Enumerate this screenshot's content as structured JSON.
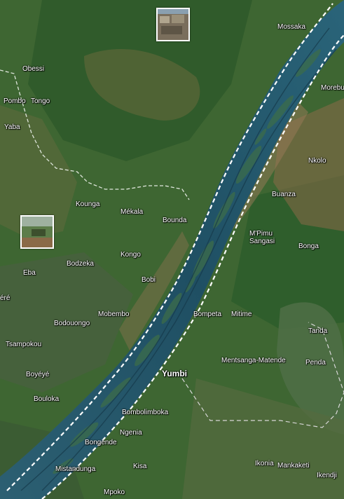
{
  "map": {
    "places": [
      {
        "id": "mossaka",
        "name": "Mossaka"
      },
      {
        "id": "obessi",
        "name": "Obessi"
      },
      {
        "id": "pombo",
        "name": "Pombo"
      },
      {
        "id": "tongo",
        "name": "Tongo"
      },
      {
        "id": "morebu",
        "name": "Morebu"
      },
      {
        "id": "yaba",
        "name": "Yaba"
      },
      {
        "id": "nkolo",
        "name": "Nkolo"
      },
      {
        "id": "buanza",
        "name": "Buanza"
      },
      {
        "id": "kounga",
        "name": "Kounga"
      },
      {
        "id": "mekala",
        "name": "Mékala"
      },
      {
        "id": "bounda",
        "name": "Bounda"
      },
      {
        "id": "mpimu",
        "name": "M'Pimu"
      },
      {
        "id": "sangasi",
        "name": "Sangasi"
      },
      {
        "id": "bonga",
        "name": "Bonga"
      },
      {
        "id": "kongo",
        "name": "Kongo"
      },
      {
        "id": "bodzeka",
        "name": "Bodzeka"
      },
      {
        "id": "eba",
        "name": "Eba"
      },
      {
        "id": "bobi",
        "name": "Bobi"
      },
      {
        "id": "ere",
        "name": "éré"
      },
      {
        "id": "mobembo",
        "name": "Mobembo"
      },
      {
        "id": "bompeta",
        "name": "Bompeta"
      },
      {
        "id": "mitime",
        "name": "Mitime"
      },
      {
        "id": "bodouongo",
        "name": "Bodouongo"
      },
      {
        "id": "tanda",
        "name": "Tanda"
      },
      {
        "id": "tsampokou",
        "name": "Tsampokou"
      },
      {
        "id": "mentsanga",
        "name": "Mentsanga-Matende"
      },
      {
        "id": "penda",
        "name": "Penda"
      },
      {
        "id": "boyeye",
        "name": "Boyéyé"
      },
      {
        "id": "yumbi",
        "name": "Yumbi"
      },
      {
        "id": "bouloka",
        "name": "Bouloka"
      },
      {
        "id": "bombolimboka",
        "name": "Bombolimboka"
      },
      {
        "id": "ngenia",
        "name": "Ngenia"
      },
      {
        "id": "bongende",
        "name": "Bongende"
      },
      {
        "id": "kisa",
        "name": "Kisa"
      },
      {
        "id": "ikonia",
        "name": "Ikonia"
      },
      {
        "id": "mankaketi",
        "name": "Mankaketi"
      },
      {
        "id": "mistandunga",
        "name": "Mistandunga"
      },
      {
        "id": "ikendji",
        "name": "Ikendji"
      },
      {
        "id": "mpoko",
        "name": "Mpoko"
      }
    ],
    "photos": [
      {
        "id": "photo-village",
        "subject": "village-photo-thumbnail"
      },
      {
        "id": "photo-river",
        "subject": "riverbank-photo-thumbnail"
      }
    ]
  }
}
